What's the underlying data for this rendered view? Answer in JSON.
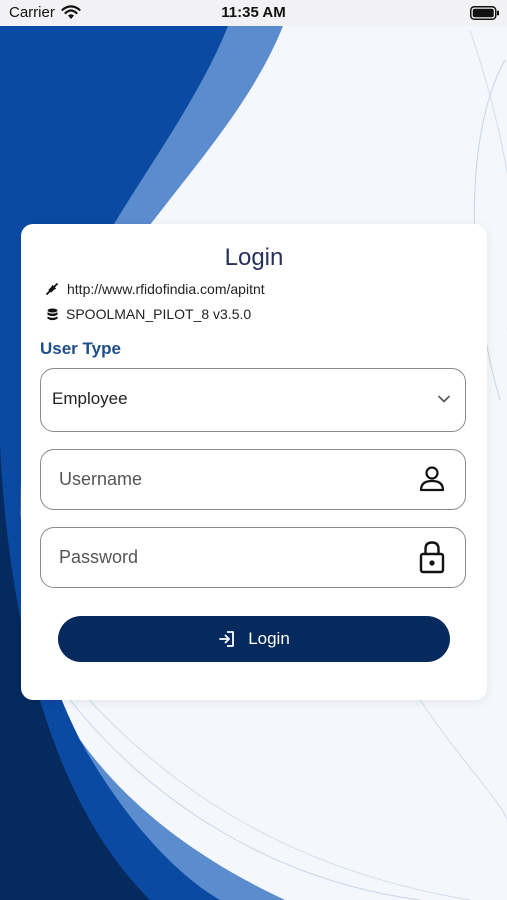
{
  "status_bar": {
    "carrier": "Carrier",
    "time": "11:35 AM"
  },
  "login_card": {
    "title": "Login",
    "server_url": "http://www.rfidofindia.com/apitnt",
    "app_version": "SPOOLMAN_PILOT_8 v3.5.0",
    "user_type_label": "User Type",
    "user_type_value": "Employee",
    "username_placeholder": "Username",
    "password_placeholder": "Password",
    "login_button_label": "Login"
  },
  "icons": {
    "server": "plug-icon",
    "version": "database-icon",
    "dropdown": "chevron-down-icon",
    "username": "user-icon",
    "password": "lock-icon",
    "login": "login-arrow-icon"
  },
  "colors": {
    "brand_dark": "#062a5e",
    "brand_blue": "#0b4aa2",
    "label_blue": "#1d4e8a",
    "title": "#28305e",
    "background_light": "#f4f7fc"
  }
}
